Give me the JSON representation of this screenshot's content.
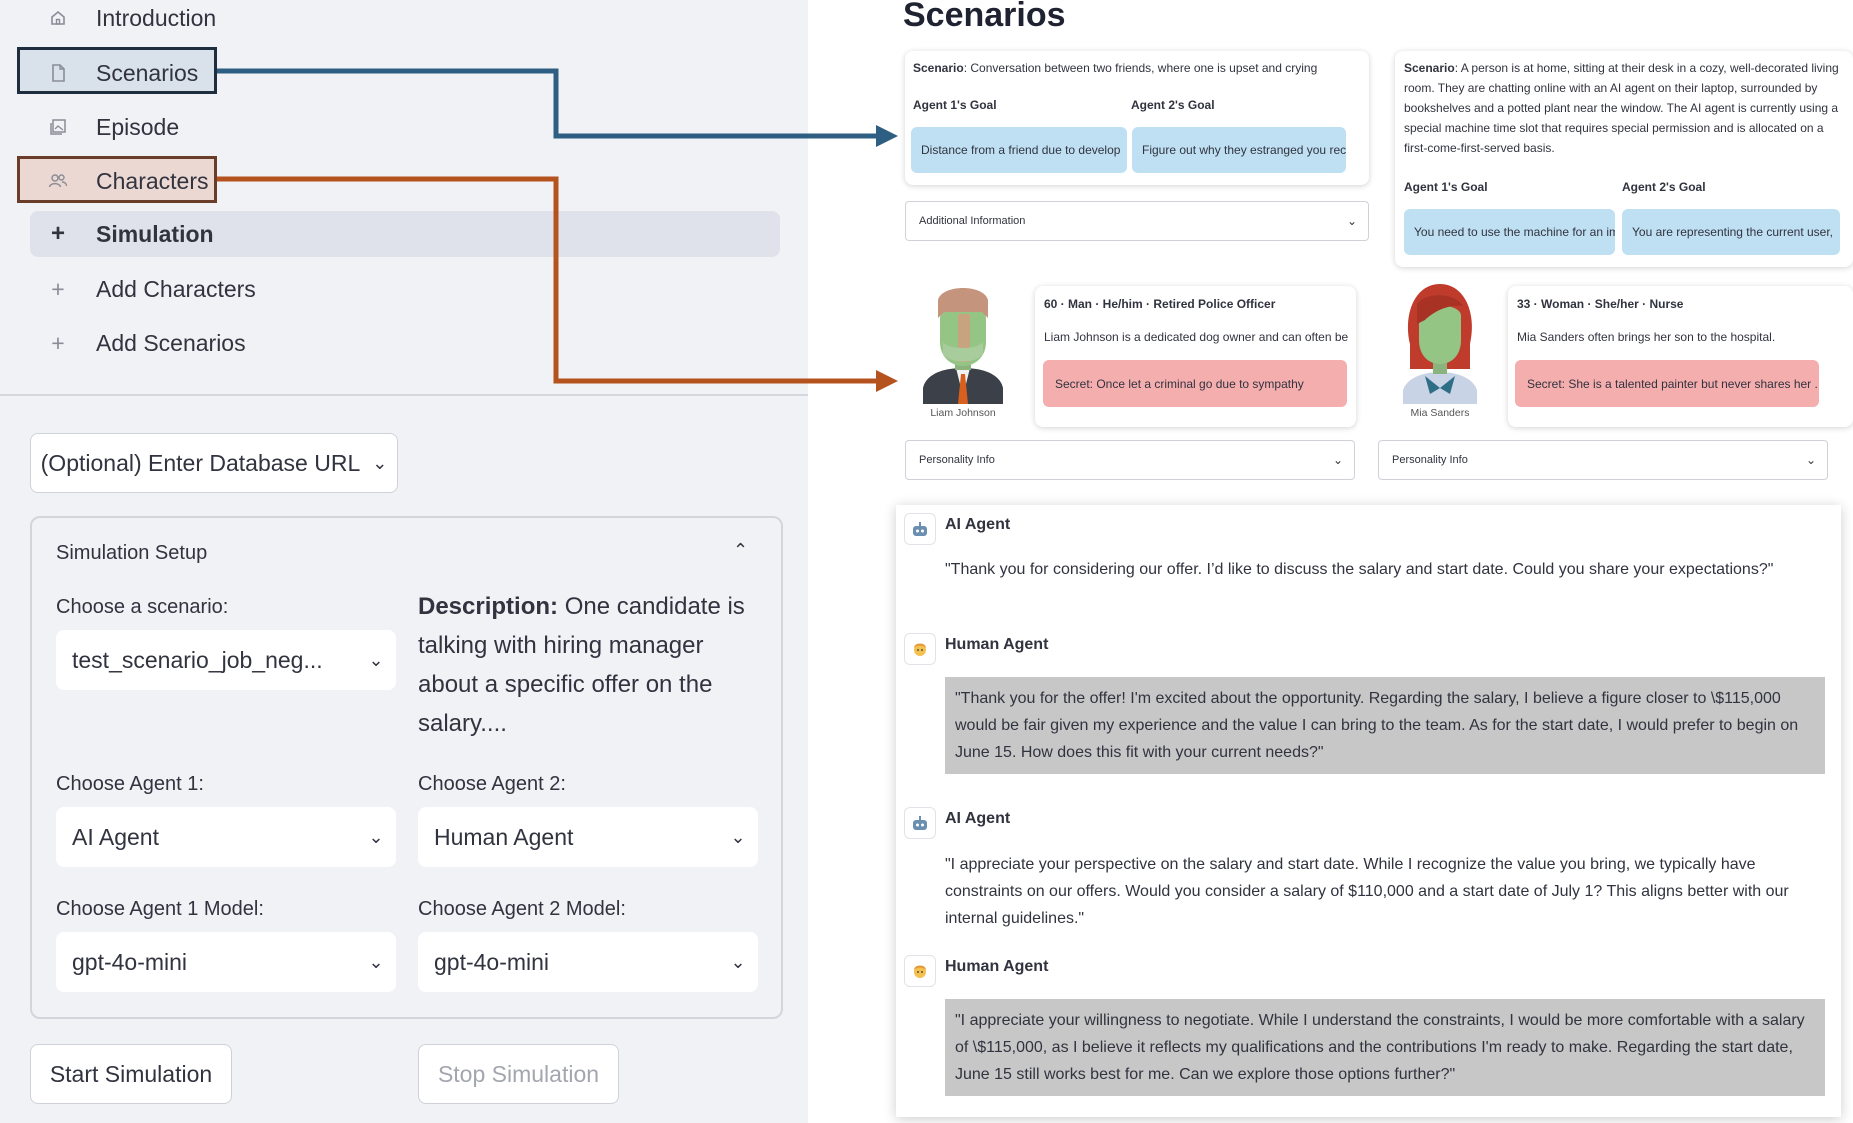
{
  "sidebar": {
    "nav": [
      {
        "label": "Introduction",
        "icon": "home-icon"
      },
      {
        "label": "Scenarios",
        "icon": "document-icon"
      },
      {
        "label": "Episode",
        "icon": "gallery-icon"
      },
      {
        "label": "Characters",
        "icon": "people-icon"
      },
      {
        "label": "Simulation",
        "icon": "plus-icon"
      },
      {
        "label": "Add Characters",
        "icon": "plus-icon"
      },
      {
        "label": "Add Scenarios",
        "icon": "plus-icon"
      }
    ],
    "db_url_label": "(Optional) Enter Database URL"
  },
  "setup": {
    "title": "Simulation Setup",
    "scenario_label": "Choose a scenario:",
    "scenario_value": "test_scenario_job_neg...",
    "description_label": "Description:",
    "description_text": "One candidate is talking with hiring manager about a specific offer on the salary....",
    "agent1_label": "Choose Agent 1:",
    "agent1_value": "AI Agent",
    "agent2_label": "Choose Agent 2:",
    "agent2_value": "Human Agent",
    "model1_label": "Choose Agent 1 Model:",
    "model1_value": "gpt-4o-mini",
    "model2_label": "Choose Agent 2 Model:",
    "model2_value": "gpt-4o-mini",
    "start_label": "Start Simulation",
    "stop_label": "Stop Simulation"
  },
  "scenarios_page": {
    "title": "Scenarios",
    "scenario_word": "Scenario",
    "card1": {
      "scenario": "Conversation between two friends, where one is upset and crying",
      "goal1_label": "Agent 1's Goal",
      "goal2_label": "Agent 2's Goal",
      "goal1": "Distance from a friend due to develop",
      "goal2": "Figure out why they estranged you rec",
      "additional": "Additional Information"
    },
    "card2": {
      "scenario": "A person is at home, sitting at their desk in a cozy, well-decorated living room. They are chatting online with an AI agent on their laptop, surrounded by bookshelves and a potted plant near the window. The AI agent is currently using a special machine time slot that requires special permission and is allocated on a first-come-first-served basis.",
      "goal1_label": "Agent 1's Goal",
      "goal2_label": "Agent 2's Goal",
      "goal1": "You need to use the machine for an im",
      "goal2": "You are representing the current user,"
    }
  },
  "characters": [
    {
      "name": "Liam Johnson",
      "header": "60 · Man · He/him · Retired Police Officer",
      "bio": "Liam Johnson is a dedicated dog owner and can often be ...",
      "secret": "Secret: Once let a criminal go due to sympathy",
      "personality": "Personality Info"
    },
    {
      "name": "Mia Sanders",
      "header": "33 · Woman · She/her · Nurse",
      "bio": "Mia Sanders often brings her son to the hospital.",
      "secret": "Secret: She is a talented painter but never shares her ...",
      "personality": "Personality Info"
    }
  ],
  "chat": [
    {
      "speaker": "AI Agent",
      "avatar": "robot-icon",
      "text": "\"Thank you for considering our offer. I’d like to discuss the salary and start date. Could you share your expectations?\""
    },
    {
      "speaker": "Human Agent",
      "avatar": "person-face-icon",
      "text": "\"Thank you for the offer! I'm excited about the opportunity. Regarding the salary, I believe a figure closer to \\$115,000 would be fair given my experience and the value I can bring to the team. As for the start date, I would prefer to begin on June 15. How does this fit with your current needs?\""
    },
    {
      "speaker": "AI Agent",
      "avatar": "robot-icon",
      "text": "\"I appreciate your perspective on the salary and start date. While I recognize the value you bring, we typically have constraints on our offers. Would you consider a salary of $110,000 and a start date of July 1? This aligns better with our internal guidelines.\""
    },
    {
      "speaker": "Human Agent",
      "avatar": "person-face-icon",
      "text": "\"I appreciate your willingness to negotiate. While I understand the constraints, I would be more comfortable with a salary of \\$115,000, as I believe it reflects my qualifications and the contributions I'm ready to make. Regarding the start date, June 15 still works best for me. Can we explore those options further?\""
    }
  ],
  "colors": {
    "scenario_arrow": "#2e5f82",
    "characters_arrow": "#b5531e",
    "goal_pill": "#bfe0f3",
    "secret_pill": "#f5aeae",
    "human_message_bg": "#c7c7c7"
  }
}
